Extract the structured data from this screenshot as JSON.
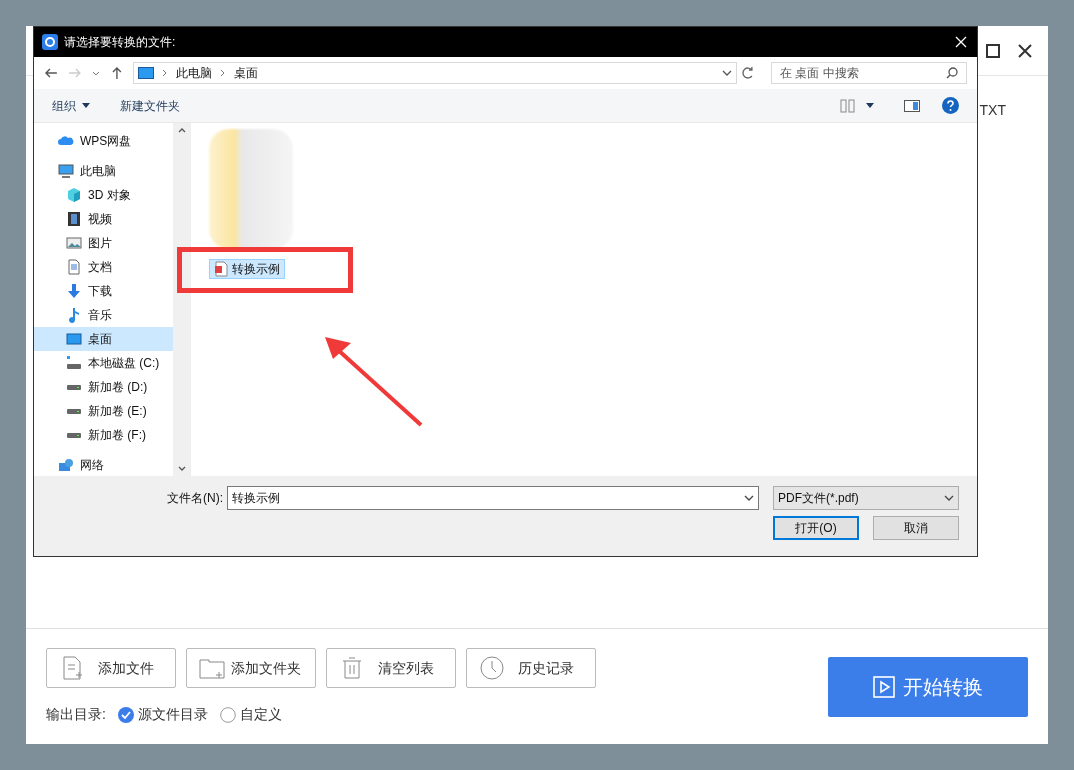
{
  "app": {
    "tab_text": "TXT",
    "buttons": [
      {
        "label": "添加文件",
        "kind": "file"
      },
      {
        "label": "添加文件夹",
        "kind": "folder"
      },
      {
        "label": "清空列表",
        "kind": "trash"
      },
      {
        "label": "历史记录",
        "kind": "history"
      }
    ],
    "output": {
      "label": "输出目录:",
      "options": [
        {
          "label": "源文件目录",
          "selected": true
        },
        {
          "label": "自定义",
          "selected": false
        }
      ]
    },
    "start_button": "开始转换"
  },
  "dialog": {
    "title": "请选择要转换的文件:",
    "breadcrumb": [
      "此电脑",
      "桌面"
    ],
    "search": {
      "placeholder": "在 桌面 中搜索"
    },
    "toolbar": {
      "organize": "组织",
      "new_folder": "新建文件夹"
    },
    "sidebar": [
      {
        "label": "WPS网盘",
        "kind": "cloud",
        "selected": false
      },
      {
        "label": "此电脑",
        "kind": "pc",
        "selected": false,
        "children": [
          {
            "label": "3D 对象",
            "kind": "cube",
            "selected": false
          },
          {
            "label": "视频",
            "kind": "video",
            "selected": false
          },
          {
            "label": "图片",
            "kind": "picture",
            "selected": false
          },
          {
            "label": "文档",
            "kind": "document",
            "selected": false
          },
          {
            "label": "下载",
            "kind": "download",
            "selected": false
          },
          {
            "label": "音乐",
            "kind": "music",
            "selected": false
          },
          {
            "label": "桌面",
            "kind": "desktop",
            "selected": true
          },
          {
            "label": "本地磁盘 (C:)",
            "kind": "system-drive",
            "selected": false
          },
          {
            "label": "新加卷 (D:)",
            "kind": "drive",
            "selected": false
          },
          {
            "label": "新加卷 (E:)",
            "kind": "drive",
            "selected": false
          },
          {
            "label": "新加卷 (F:)",
            "kind": "drive",
            "selected": false
          }
        ]
      },
      {
        "label": "网络",
        "kind": "network",
        "selected": false
      }
    ],
    "files": [
      {
        "name": "转换示例",
        "selected": true
      }
    ],
    "filename": {
      "label": "文件名(N):",
      "value": "转换示例"
    },
    "filetype": "PDF文件(*.pdf)",
    "buttons": [
      {
        "label": "打开(O)",
        "kind": "primary"
      },
      {
        "label": "取消",
        "kind": "normal"
      }
    ]
  }
}
